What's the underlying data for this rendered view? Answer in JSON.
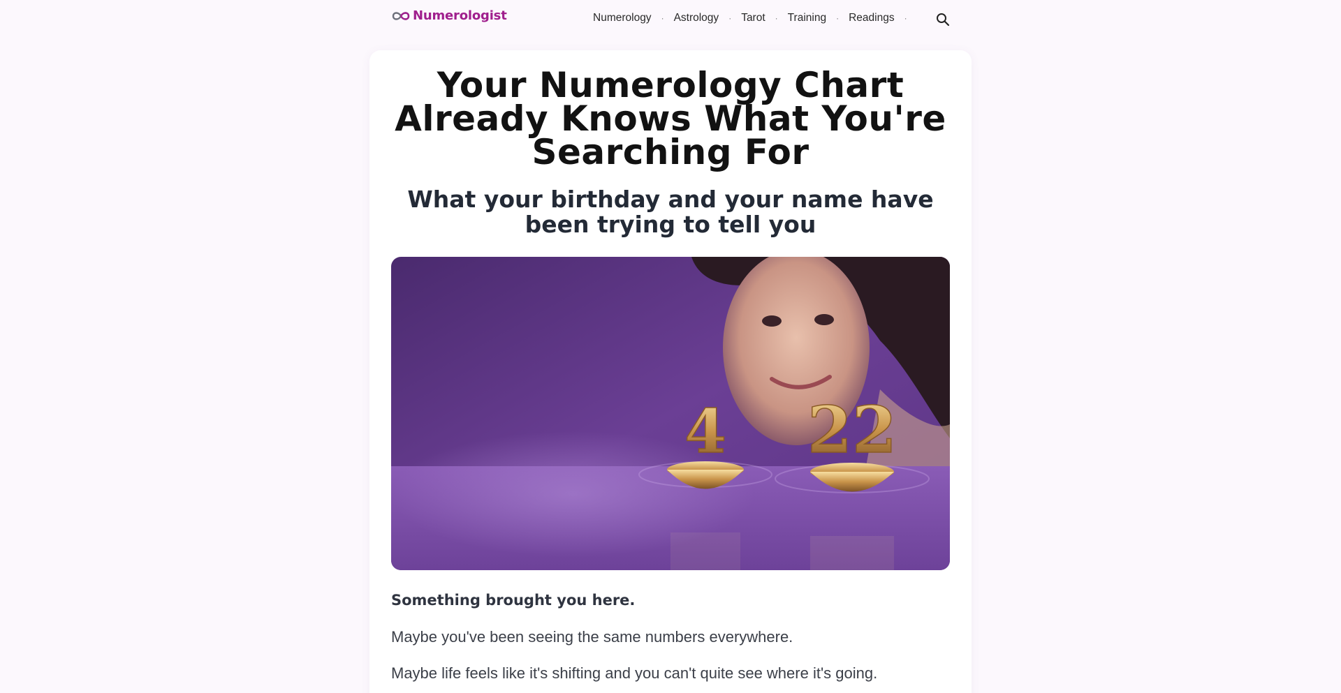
{
  "brand": {
    "name": "Numerologist",
    "color": "#a01f8d"
  },
  "nav": {
    "items": [
      {
        "label": "Numerology"
      },
      {
        "label": "Astrology"
      },
      {
        "label": "Tarot"
      },
      {
        "label": "Training"
      },
      {
        "label": "Readings"
      }
    ],
    "separator": "·",
    "search_icon": "search-icon"
  },
  "article": {
    "title": "Your Numerology Chart Already Knows What You're Searching For",
    "subtitle": "What your birthday and your name have been trying to tell you",
    "hero_image": {
      "numbers": [
        "4",
        "22"
      ],
      "accent": "#7a4aa8"
    },
    "lead": "Something brought you here.",
    "paragraphs": [
      "Maybe you've been seeing the same numbers everywhere.",
      "Maybe life feels like it's shifting and you can't quite see where it's going."
    ]
  }
}
